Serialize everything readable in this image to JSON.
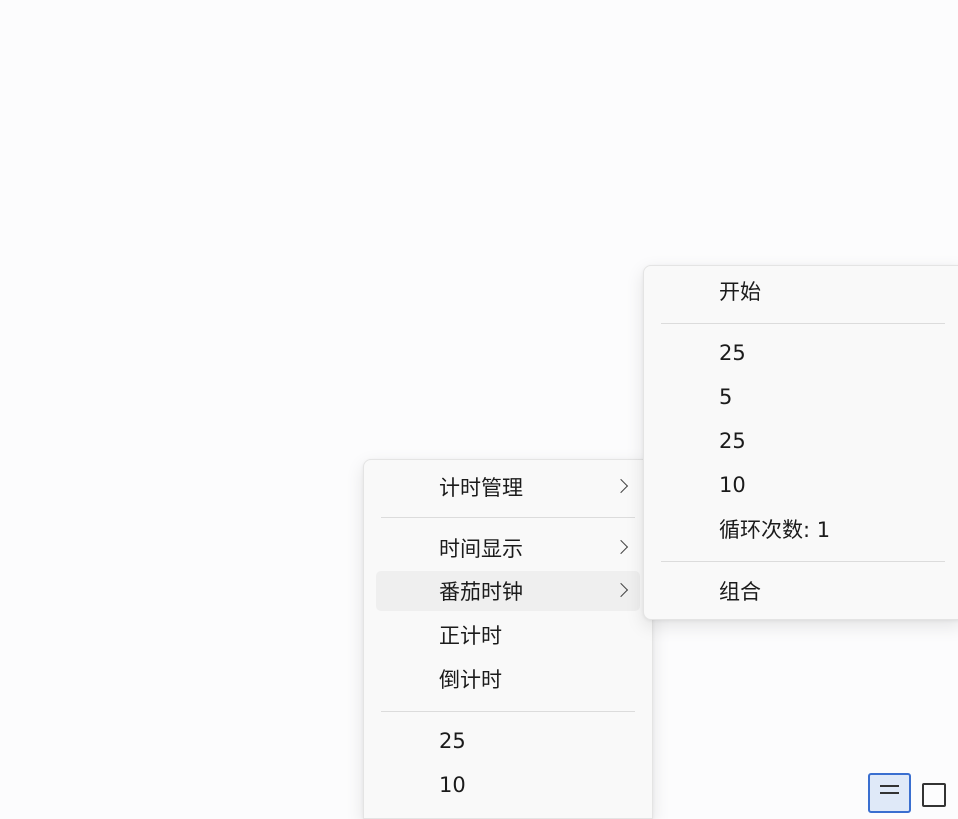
{
  "main_menu": {
    "items": [
      {
        "label": "计时管理",
        "has_submenu": true
      },
      {
        "label": "时间显示",
        "has_submenu": true
      },
      {
        "label": "番茄时钟",
        "has_submenu": true,
        "state": "hover"
      },
      {
        "label": "正计时",
        "has_submenu": false
      },
      {
        "label": "倒计时",
        "has_submenu": false
      },
      {
        "label": "25",
        "has_submenu": false
      },
      {
        "label": "10",
        "has_submenu": false
      }
    ]
  },
  "sub_menu": {
    "parent": "番茄时钟",
    "items": [
      {
        "label": "开始"
      },
      {
        "label": "25"
      },
      {
        "label": "5"
      },
      {
        "label": "25"
      },
      {
        "label": "10"
      },
      {
        "label": "循环次数: 1"
      },
      {
        "label": "组合"
      }
    ]
  },
  "taskbar": {
    "icons": [
      "menu-lines-icon",
      "square-icon"
    ]
  },
  "colors": {
    "menu_background": "#f9f9f9",
    "hover_background": "#efefef",
    "separator": "#dcdcdc",
    "selected_icon_border": "#3a6fd0"
  }
}
